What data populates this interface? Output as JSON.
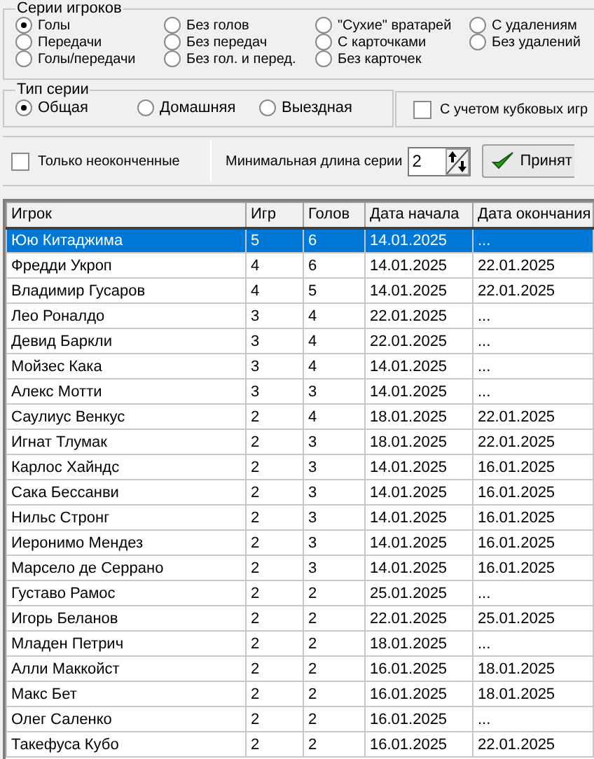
{
  "series_group": {
    "title": "Серии игроков",
    "options": [
      {
        "label": "Голы",
        "selected": true
      },
      {
        "label": "Передачи",
        "selected": false
      },
      {
        "label": "Голы/передачи",
        "selected": false
      },
      {
        "label": "Без голов",
        "selected": false
      },
      {
        "label": "Без передач",
        "selected": false
      },
      {
        "label": "Без гол. и перед.",
        "selected": false
      },
      {
        "label": "\"Сухие\" вратарей",
        "selected": false
      },
      {
        "label": "С карточками",
        "selected": false
      },
      {
        "label": "Без карточек",
        "selected": false
      },
      {
        "label": "С удалениям",
        "selected": false
      },
      {
        "label": "Без удалений",
        "selected": false
      }
    ]
  },
  "type_group": {
    "title": "Тип серии",
    "options": [
      {
        "label": "Общая",
        "selected": true
      },
      {
        "label": "Домашняя",
        "selected": false
      },
      {
        "label": "Выездная",
        "selected": false
      }
    ]
  },
  "cup_games": {
    "label": "С учетом кубковых игр",
    "checked": false
  },
  "only_unfinished": {
    "label": "Только неоконченные",
    "checked": false
  },
  "min_length": {
    "label": "Минимальная длина серии",
    "value": "2"
  },
  "accept_button": {
    "label": "Принят"
  },
  "table": {
    "columns": [
      "Игрок",
      "Игр",
      "Голов",
      "Дата начала",
      "Дата окончания"
    ],
    "rows": [
      {
        "cells": [
          "Юю Китаджима",
          "5",
          "6",
          "14.01.2025",
          "..."
        ],
        "selected": true
      },
      {
        "cells": [
          "Фредди Укроп",
          "4",
          "6",
          "14.01.2025",
          "22.01.2025"
        ],
        "selected": false
      },
      {
        "cells": [
          "Владимир Гусаров",
          "4",
          "5",
          "14.01.2025",
          "22.01.2025"
        ],
        "selected": false
      },
      {
        "cells": [
          "Лео Роналдо",
          "3",
          "4",
          "22.01.2025",
          "..."
        ],
        "selected": false
      },
      {
        "cells": [
          "Девид Баркли",
          "3",
          "4",
          "22.01.2025",
          "..."
        ],
        "selected": false
      },
      {
        "cells": [
          "Мойзес Кака",
          "3",
          "4",
          "14.01.2025",
          "..."
        ],
        "selected": false
      },
      {
        "cells": [
          "Алекс Мотти",
          "3",
          "3",
          "14.01.2025",
          "..."
        ],
        "selected": false
      },
      {
        "cells": [
          "Саулиус Венкус",
          "2",
          "4",
          "18.01.2025",
          "22.01.2025"
        ],
        "selected": false
      },
      {
        "cells": [
          "Игнат Тлумак",
          "2",
          "3",
          "18.01.2025",
          "22.01.2025"
        ],
        "selected": false
      },
      {
        "cells": [
          "Карлос Хайндс",
          "2",
          "3",
          "14.01.2025",
          "16.01.2025"
        ],
        "selected": false
      },
      {
        "cells": [
          "Сака Бессанви",
          "2",
          "3",
          "14.01.2025",
          "16.01.2025"
        ],
        "selected": false
      },
      {
        "cells": [
          "Нильс Стронг",
          "2",
          "3",
          "14.01.2025",
          "16.01.2025"
        ],
        "selected": false
      },
      {
        "cells": [
          "Иеронимо Мендез",
          "2",
          "3",
          "14.01.2025",
          "16.01.2025"
        ],
        "selected": false
      },
      {
        "cells": [
          "Марсело де Серрано",
          "2",
          "3",
          "14.01.2025",
          "16.01.2025"
        ],
        "selected": false
      },
      {
        "cells": [
          "Густаво Рамос",
          "2",
          "2",
          "25.01.2025",
          "..."
        ],
        "selected": false
      },
      {
        "cells": [
          "Игорь Беланов",
          "2",
          "2",
          "22.01.2025",
          "25.01.2025"
        ],
        "selected": false
      },
      {
        "cells": [
          "Младен Петрич",
          "2",
          "2",
          "18.01.2025",
          "..."
        ],
        "selected": false
      },
      {
        "cells": [
          "Алли Маккойст",
          "2",
          "2",
          "16.01.2025",
          "18.01.2025"
        ],
        "selected": false
      },
      {
        "cells": [
          "Макс Бет",
          "2",
          "2",
          "16.01.2025",
          "18.01.2025"
        ],
        "selected": false
      },
      {
        "cells": [
          "Олег Саленко",
          "2",
          "2",
          "16.01.2025",
          "..."
        ],
        "selected": false
      },
      {
        "cells": [
          "Такефуса Кубо",
          "2",
          "2",
          "16.01.2025",
          "22.01.2025"
        ],
        "selected": false
      }
    ]
  }
}
